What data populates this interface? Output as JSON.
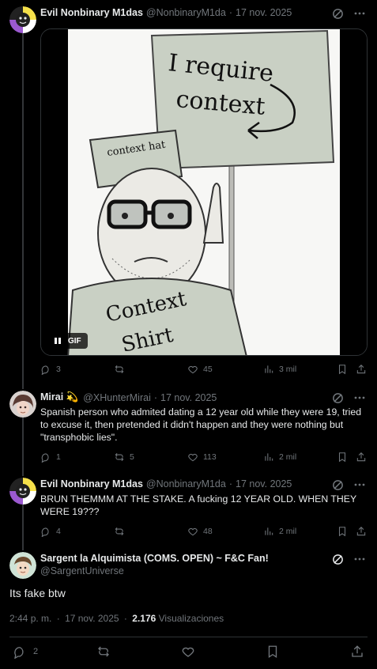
{
  "tweets": [
    {
      "name": "Evil Nonbinary M1das",
      "handle": "@NonbinaryM1da",
      "sep": "·",
      "date": "17 nov. 2025",
      "gif_label": "GIF",
      "meme_text": {
        "sign_line1": "I require",
        "sign_line2": "context",
        "hat": "context hat",
        "shirt_line1": "Context",
        "shirt_line2": "Shirt"
      },
      "stats": {
        "replies": "3",
        "retweets": "",
        "likes": "45",
        "views": "3 mil"
      }
    },
    {
      "name": "Mirai 💫",
      "handle": "@XHunterMirai",
      "sep": "·",
      "date": "17 nov. 2025",
      "text": "Spanish person who admited dating a 12 year old while they were 19, tried to excuse it, then pretended it didn't happen and they were nothing but \"transphobic lies\".",
      "stats": {
        "replies": "1",
        "retweets": "5",
        "likes": "113",
        "views": "2 mil"
      }
    },
    {
      "name": "Evil Nonbinary M1das",
      "handle": "@NonbinaryM1da",
      "sep": "·",
      "date": "17 nov. 2025",
      "text": "BRUN THEMMM AT THE STAKE. A fucking 12 YEAR OLD. WHEN THEY WERE 19???",
      "stats": {
        "replies": "4",
        "retweets": "",
        "likes": "48",
        "views": "2 mil"
      }
    }
  ],
  "main_tweet": {
    "name": "Sargent la Alquimista (COMS. OPEN) ~ F&C Fan!",
    "handle": "@SargentUniverse",
    "text": "Its fake btw",
    "time": "2:44 p. m.",
    "sep": "·",
    "date": "17 nov. 2025",
    "views_count": "2.176",
    "views_label": "Visualizaciones",
    "replies": "2"
  },
  "colors": {
    "background": "#000000",
    "text": "#e7e9ea",
    "muted": "#71767b",
    "border": "#2f3336"
  }
}
